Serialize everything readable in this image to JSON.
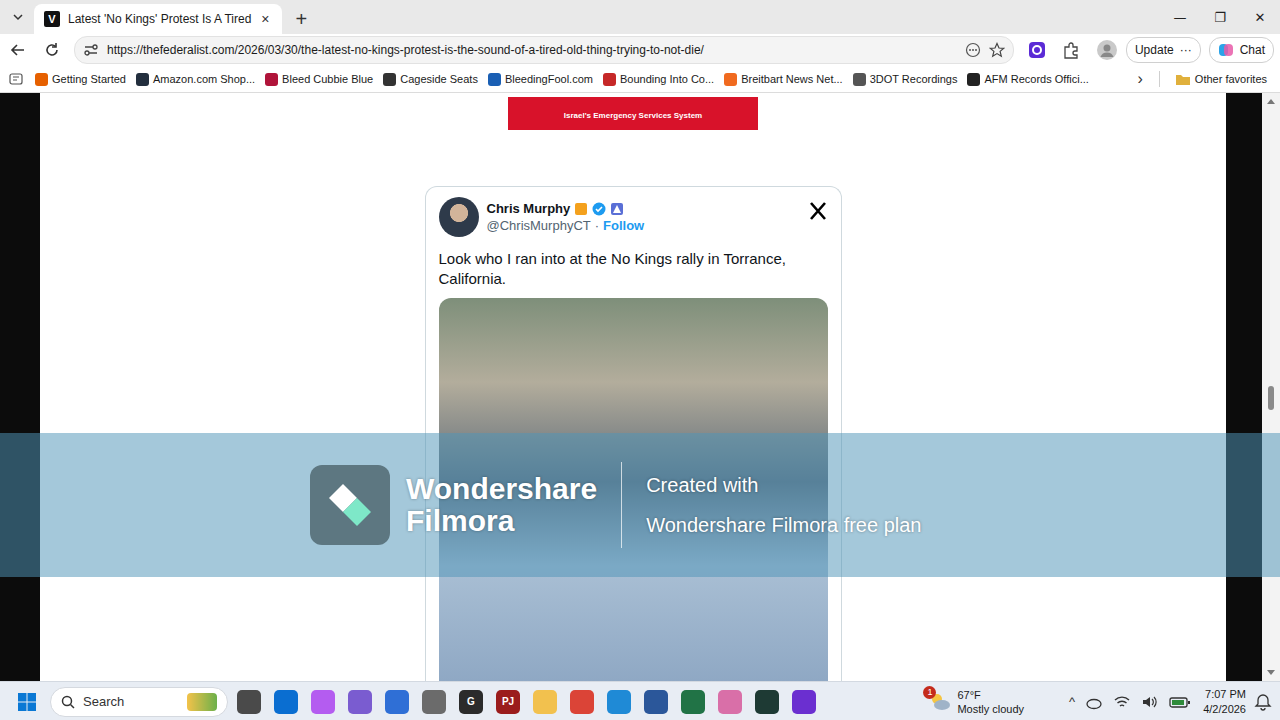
{
  "tabs": [
    {
      "label": "Latest 'No Kings' Protest Is A Tired",
      "favicon": "V",
      "close": "×",
      "selected": true
    }
  ],
  "new_tab": "+",
  "window": {
    "controls": [
      "—",
      "❐",
      "✕"
    ]
  },
  "address_bar": {
    "url": "https://thefederalist.com/2026/03/30/the-latest-no-kings-protest-is-the-sound-of-a-tired-old-thing-trying-to-not-die/",
    "update": "Update",
    "more": "···",
    "chat": "Chat"
  },
  "bookmarks": {
    "items": [
      {
        "label": "Getting Started",
        "color": "#e66000"
      },
      {
        "label": "Amazon.com Shop...",
        "color": "#232f3e"
      },
      {
        "label": "Bleed Cubbie Blue",
        "color": "#b0143a"
      },
      {
        "label": "Cageside Seats",
        "color": "#333333"
      },
      {
        "label": "BleedingFool.com",
        "color": "#1a5fb4"
      },
      {
        "label": "Bounding Into Co...",
        "color": "#c62828"
      },
      {
        "label": "Breitbart News Net...",
        "color": "#f06a1f"
      },
      {
        "label": "3DOT Recordings",
        "color": "#555555"
      },
      {
        "label": "AFM Records Offici...",
        "color": "#222222"
      }
    ],
    "overflow": "›",
    "other": "Other favorites"
  },
  "page": {
    "banner": "Israel's Emergency Services System",
    "scroll": {
      "level": 0.52
    },
    "tweet": {
      "name": "Chris Murphy",
      "handle": "@ChrisMurphyCT",
      "separator": "·",
      "follow": "Follow",
      "text": "Look who I ran into at the No Kings rally in Torrance, California."
    }
  },
  "watermark": {
    "brand_line1": "Wondershare",
    "brand_line2": "Filmora",
    "caption_line1": "Created with",
    "caption_line2": "Wondershare Filmora free plan"
  },
  "taskbar": {
    "search": "Search",
    "apps": [
      {
        "color": "#4a4a4a"
      },
      {
        "color": "#0a6ed1"
      },
      {
        "color": "#b45cf0"
      },
      {
        "color": "#7a5cd0"
      },
      {
        "color": "#2f6fd6"
      },
      {
        "color": "#6b6b6b"
      },
      {
        "color": "#2b2b2b",
        "label": "G"
      },
      {
        "color": "#9b1c1c",
        "label": "PJ"
      },
      {
        "color": "#f2c14e"
      },
      {
        "color": "#db4437"
      },
      {
        "color": "#1f8ad6"
      },
      {
        "color": "#2b579a"
      },
      {
        "color": "#217346"
      },
      {
        "color": "#d96fa8"
      },
      {
        "color": "#1e3a34"
      },
      {
        "color": "#6b2fd0"
      }
    ],
    "weather": {
      "badge": "1",
      "temp": "67°F",
      "condition": "Mostly cloudy"
    },
    "tray_toggle": "^",
    "time": "7:07 PM",
    "date": "4/2/2026"
  }
}
